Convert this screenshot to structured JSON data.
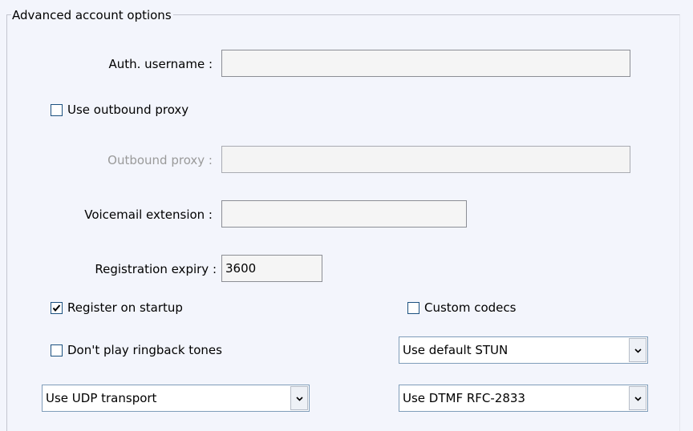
{
  "group": {
    "title": "Advanced account options"
  },
  "auth_username": {
    "label": "Auth. username :",
    "value": ""
  },
  "use_outbound_proxy": {
    "label": "Use outbound proxy",
    "checked": false
  },
  "outbound_proxy": {
    "label": "Outbound proxy :",
    "value": "",
    "disabled": true
  },
  "voicemail_extension": {
    "label": "Voicemail extension :",
    "value": ""
  },
  "registration_expiry": {
    "label": "Registration expiry  :",
    "value": "3600"
  },
  "register_on_startup": {
    "label": "Register on startup",
    "checked": true
  },
  "custom_codecs": {
    "label": "Custom codecs",
    "checked": false
  },
  "dont_play_ringback": {
    "label": "Don't play ringback tones",
    "checked": false
  },
  "stun_select": {
    "value": "Use default STUN"
  },
  "transport_select": {
    "value": "Use UDP transport"
  },
  "dtmf_select": {
    "value": "Use DTMF RFC-2833"
  },
  "icons": {
    "dropdown": "chevron-down-icon",
    "check": "checkmark-icon"
  },
  "colors": {
    "background": "#f3f5fc",
    "checkbox_border": "#1c5180",
    "combo_border": "#7f9db9",
    "disabled_text": "#9a9a9a"
  }
}
